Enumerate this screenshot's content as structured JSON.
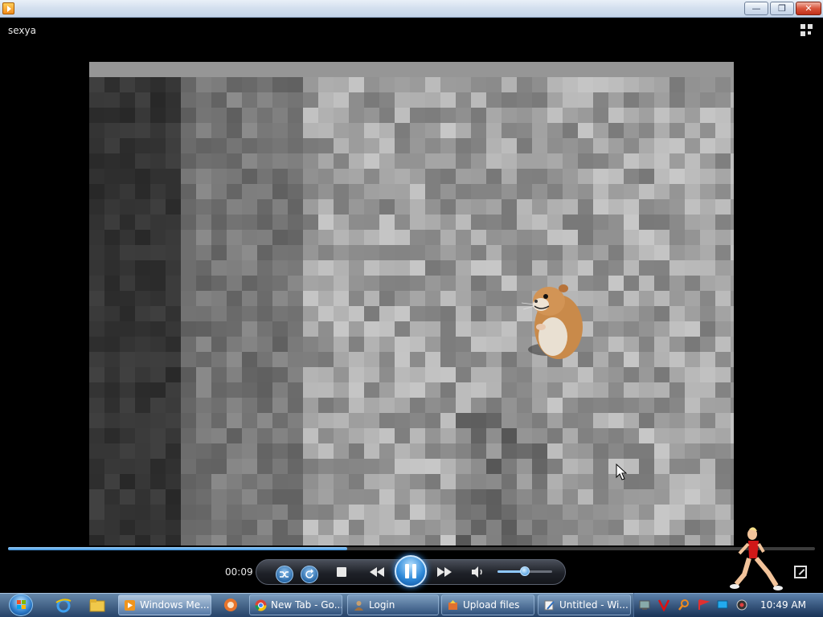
{
  "window": {
    "min_label": "—",
    "max_label": "❐",
    "close_label": "✕"
  },
  "media": {
    "title": "sexya"
  },
  "player": {
    "elapsed": "00:09",
    "progress_fraction": 0.42,
    "volume_fraction": 0.5,
    "state": "playing"
  },
  "taskbar": {
    "items": [
      {
        "label": "Windows Me...",
        "icon": "media-player-icon",
        "active": true
      },
      {
        "label": "New Tab - Go...",
        "icon": "chrome-icon",
        "active": false
      },
      {
        "label": "Login",
        "icon": "login-page-icon",
        "active": false
      },
      {
        "label": "Upload files",
        "icon": "upload-icon",
        "active": false
      },
      {
        "label": "Untitled - Wi...",
        "icon": "editor-icon",
        "active": false
      }
    ],
    "clock": "10:49 AM"
  },
  "colors": {
    "accent": "#2f8ad9",
    "taskbar": "#2b4a72",
    "close": "#c0301a"
  }
}
